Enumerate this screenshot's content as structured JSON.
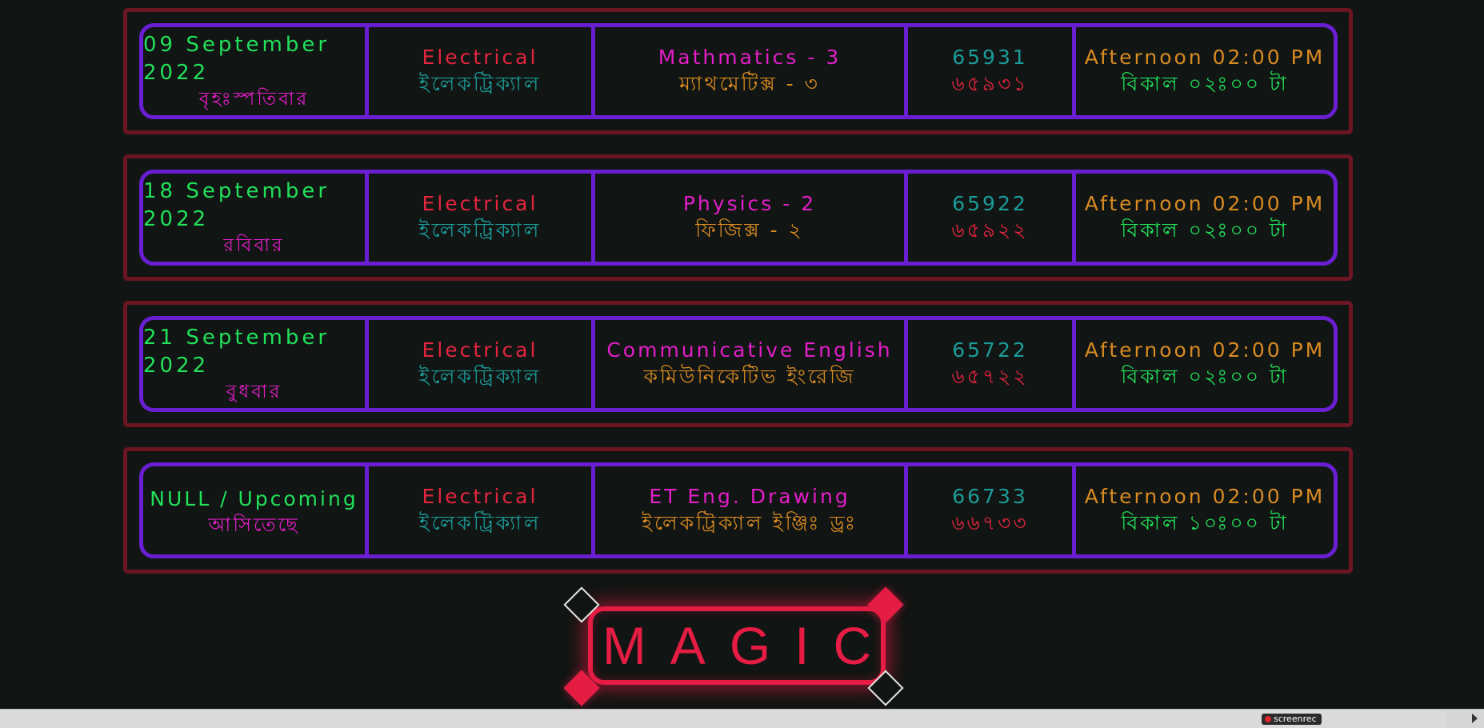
{
  "colors": {
    "background": "#111513",
    "outer_border": "#6b1622",
    "inner_border": "#6a1ed2",
    "green": "#22e05a",
    "magenta": "#e21ec8",
    "red": "#e3253f",
    "teal": "#1b9c9a",
    "orange": "#d88a22",
    "magic_red": "#e51c43"
  },
  "rows": [
    {
      "date_en": "09 September 2022",
      "date_bn": "বৃহঃস্পতিবার",
      "dept_en": "Electrical",
      "dept_bn": "ইলেকট্রিক্যাল",
      "subject_en": "Mathmatics - 3",
      "subject_bn": "ম্যাথমেটিক্স - ৩",
      "code_en": "65931",
      "code_bn": "৬৫৯৩১",
      "time_en": "Afternoon 02:00 PM",
      "time_bn": "বিকাল ০২ঃ০০ টা"
    },
    {
      "date_en": "18 September 2022",
      "date_bn": "রবিবার",
      "dept_en": "Electrical",
      "dept_bn": "ইলেকট্রিক্যাল",
      "subject_en": "Physics - 2",
      "subject_bn": "ফিজিক্স - ২",
      "code_en": "65922",
      "code_bn": "৬৫৯২২",
      "time_en": "Afternoon 02:00 PM",
      "time_bn": "বিকাল ০২ঃ০০ টা"
    },
    {
      "date_en": "21 September 2022",
      "date_bn": "বুধবার",
      "dept_en": "Electrical",
      "dept_bn": "ইলেকট্রিক্যাল",
      "subject_en": "Communicative English",
      "subject_bn": "কমিউনিকেটিভ ইংরেজি",
      "code_en": "65722",
      "code_bn": "৬৫৭২২",
      "time_en": "Afternoon 02:00 PM",
      "time_bn": "বিকাল ০২ঃ০০ টা"
    },
    {
      "date_en": "NULL / Upcoming",
      "date_bn": "আসিতেছে",
      "dept_en": "Electrical",
      "dept_bn": "ইলেকট্রিক্যাল",
      "subject_en": "ET Eng. Drawing",
      "subject_bn": "ইলেকট্রিক্যাল ইঞ্জিঃ ড্রঃ",
      "code_en": "66733",
      "code_bn": "৬৬৭৩৩",
      "time_en": "Afternoon 02:00 PM",
      "time_bn": "বিকাল ১০ঃ০০ টা"
    }
  ],
  "magic_button": {
    "label": "MAGIC"
  },
  "recorder_badge": {
    "label": "screenrec"
  }
}
